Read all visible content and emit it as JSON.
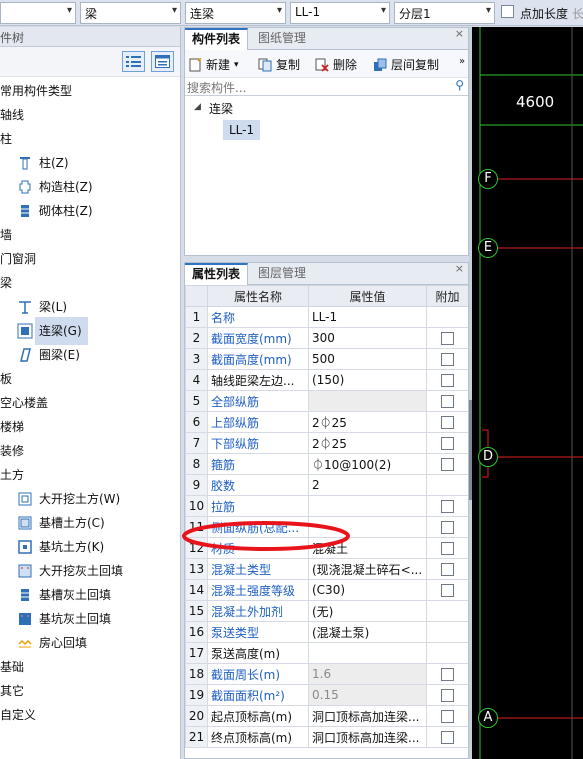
{
  "topbar": {
    "combo1": "",
    "combo2": "梁",
    "combo3": "连梁",
    "combo4": "LL-1",
    "combo5": "分层1",
    "checkbox_label": "点加长度",
    "checkbox_extra": "长"
  },
  "left_panel": {
    "title": "构件树",
    "tree": [
      {
        "label": "常用构件类型",
        "level": 0
      },
      {
        "label": "轴线",
        "level": 0
      },
      {
        "label": "柱",
        "level": 0
      },
      {
        "label": "柱(Z)",
        "level": 1,
        "icon": "column-icon"
      },
      {
        "label": "构造柱(Z)",
        "level": 1,
        "icon": "constructional-column-icon"
      },
      {
        "label": "砌体柱(Z)",
        "level": 1,
        "icon": "masonry-column-icon"
      },
      {
        "label": "墙",
        "level": 0
      },
      {
        "label": "门窗洞",
        "level": 0
      },
      {
        "label": "梁",
        "level": 0
      },
      {
        "label": "梁(L)",
        "level": 1,
        "icon": "beam-icon"
      },
      {
        "label": "连梁(G)",
        "level": 1,
        "icon": "coupling-beam-icon",
        "selected": true
      },
      {
        "label": "圈梁(E)",
        "level": 1,
        "icon": "ring-beam-icon"
      },
      {
        "label": "板",
        "level": 0
      },
      {
        "label": "空心楼盖",
        "level": 0
      },
      {
        "label": "楼梯",
        "level": 0
      },
      {
        "label": "装修",
        "level": 0
      },
      {
        "label": "土方",
        "level": 0
      },
      {
        "label": "大开挖土方(W)",
        "level": 1,
        "icon": "excavation-icon"
      },
      {
        "label": "基槽土方(C)",
        "level": 1,
        "icon": "trench-icon"
      },
      {
        "label": "基坑土方(K)",
        "level": 1,
        "icon": "pit-icon"
      },
      {
        "label": "大开挖灰土回填",
        "level": 1,
        "icon": "excavation-backfill-icon"
      },
      {
        "label": "基槽灰土回填",
        "level": 1,
        "icon": "trench-backfill-icon"
      },
      {
        "label": "基坑灰土回填",
        "level": 1,
        "icon": "pit-backfill-icon"
      },
      {
        "label": "房心回填",
        "level": 1,
        "icon": "room-backfill-icon"
      },
      {
        "label": "基础",
        "level": 0
      },
      {
        "label": "其它",
        "level": 0
      },
      {
        "label": "自定义",
        "level": 0
      }
    ]
  },
  "component_panel": {
    "tab_active": "构件列表",
    "tab_inactive": "图纸管理",
    "toolbar": {
      "new": "新建",
      "copy": "复制",
      "delete": "删除",
      "floor_copy": "层间复制"
    },
    "search_placeholder": "搜索构件...",
    "tree_root": "连梁",
    "tree_child": "LL-1"
  },
  "property_panel": {
    "tab_active": "属性列表",
    "tab_inactive": "图层管理",
    "headers": {
      "name": "属性名称",
      "value": "属性值",
      "extra": "附加"
    },
    "rows": [
      {
        "no": "1",
        "name": "名称",
        "value": "LL-1",
        "blue": true,
        "checkbox": false
      },
      {
        "no": "2",
        "name": "截面宽度(mm)",
        "value": "300",
        "blue": true,
        "checkbox": true
      },
      {
        "no": "3",
        "name": "截面高度(mm)",
        "value": "500",
        "blue": true,
        "checkbox": true
      },
      {
        "no": "4",
        "name": "轴线距梁左边...",
        "value": "(150)",
        "blue": false,
        "checkbox": true
      },
      {
        "no": "5",
        "name": "全部纵筋",
        "value": "",
        "blue": true,
        "checkbox": true,
        "shade": true
      },
      {
        "no": "6",
        "name": "上部纵筋",
        "value": "2⏀25",
        "blue": true,
        "checkbox": true
      },
      {
        "no": "7",
        "name": "下部纵筋",
        "value": "2⏀25",
        "blue": true,
        "checkbox": true
      },
      {
        "no": "8",
        "name": "箍筋",
        "value": "⏀10@100(2)",
        "blue": true,
        "checkbox": true
      },
      {
        "no": "9",
        "name": "胶数",
        "value": "2",
        "blue": true,
        "checkbox": false
      },
      {
        "no": "10",
        "name": "拉筋",
        "value": "",
        "blue": true,
        "checkbox": true
      },
      {
        "no": "11",
        "name": "侧面纵筋(总配...",
        "value": "",
        "blue": true,
        "checkbox": true
      },
      {
        "no": "12",
        "name": "材质",
        "value": "混凝土",
        "blue": true,
        "checkbox": true
      },
      {
        "no": "13",
        "name": "混凝土类型",
        "value": "(现浇混凝土碎石<...",
        "blue": true,
        "checkbox": true
      },
      {
        "no": "14",
        "name": "混凝土强度等级",
        "value": "(C30)",
        "blue": true,
        "checkbox": true
      },
      {
        "no": "15",
        "name": "混凝土外加剂",
        "value": "(无)",
        "blue": true,
        "checkbox": false
      },
      {
        "no": "16",
        "name": "泵送类型",
        "value": "(混凝土泵)",
        "blue": true,
        "checkbox": false
      },
      {
        "no": "17",
        "name": "泵送高度(m)",
        "value": "",
        "blue": false,
        "checkbox": false
      },
      {
        "no": "18",
        "name": "截面周长(m)",
        "value": "1.6",
        "blue": true,
        "checkbox": true,
        "gray": true
      },
      {
        "no": "19",
        "name": "截面面积(m²)",
        "value": "0.15",
        "blue": true,
        "checkbox": true,
        "gray": true
      },
      {
        "no": "20",
        "name": "起点顶标高(m)",
        "value": "洞口顶标高加连梁...",
        "blue": false,
        "checkbox": true
      },
      {
        "no": "21",
        "name": "终点顶标高(m)",
        "value": "洞口顶标高加连梁...",
        "blue": false,
        "checkbox": true
      }
    ]
  },
  "canvas": {
    "dimension": "4600",
    "axes": [
      "F",
      "E",
      "D",
      "A"
    ],
    "colors": {
      "axis_line": "#e02020",
      "axis_circle": "#31c331",
      "background": "#000000"
    }
  },
  "annotation": {
    "color": "#e8141c"
  }
}
